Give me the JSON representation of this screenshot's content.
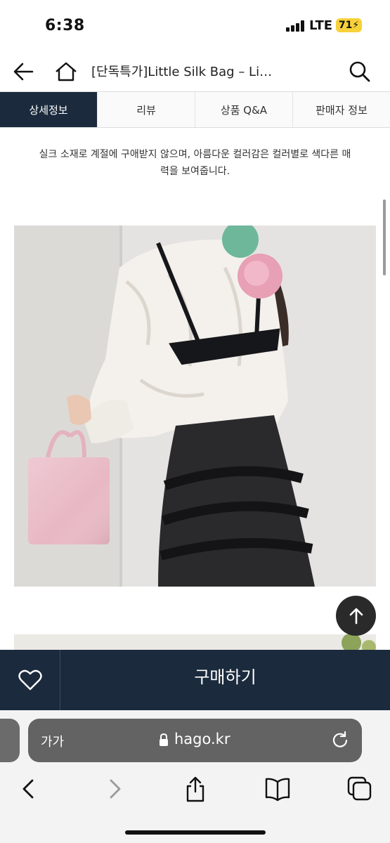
{
  "status": {
    "time": "6:38",
    "network": "LTE",
    "battery": "71"
  },
  "nav": {
    "title": "[단독특가]Little Silk Bag – Li…"
  },
  "tabs": [
    {
      "label": "상세정보",
      "active": true
    },
    {
      "label": "리뷰",
      "active": false
    },
    {
      "label": "상품 Q&A",
      "active": false
    },
    {
      "label": "판매자 정보",
      "active": false
    }
  ],
  "description": {
    "line1": "실크 소재로 계절에 구애받지 않으며, 아름다운 컬러감은 컬러별로 색다른 매",
    "line2": "력을 보여줍니다."
  },
  "buy_bar": {
    "buy_label": "구매하기"
  },
  "safari": {
    "font_size_label": "가가",
    "url": "hago.kr"
  },
  "colors": {
    "accent": "#1b2a3d",
    "battery": "#f7d13a",
    "bag_pink": "#e8b8c4"
  }
}
